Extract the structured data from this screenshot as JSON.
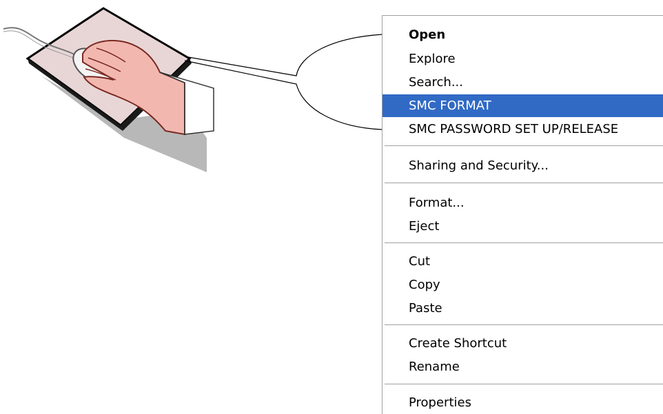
{
  "context_menu": {
    "items": [
      {
        "label": "Open",
        "bold": true
      },
      {
        "label": "Explore"
      },
      {
        "label": "Search..."
      },
      {
        "label": "SMC FORMAT",
        "highlighted": true
      },
      {
        "label": "SMC PASSWORD SET UP/RELEASE"
      },
      {
        "label": "Sharing and Security..."
      },
      {
        "label": "Format..."
      },
      {
        "label": "Eject"
      },
      {
        "label": "Cut"
      },
      {
        "label": "Copy"
      },
      {
        "label": "Paste"
      },
      {
        "label": "Create Shortcut"
      },
      {
        "label": "Rename"
      },
      {
        "label": "Properties"
      }
    ]
  },
  "colors": {
    "highlight": "#316ac5",
    "highlight_text": "#ffffff",
    "separator": "#a0a0a0"
  },
  "illustration": {
    "icon": "hand-on-mouse-icon"
  }
}
